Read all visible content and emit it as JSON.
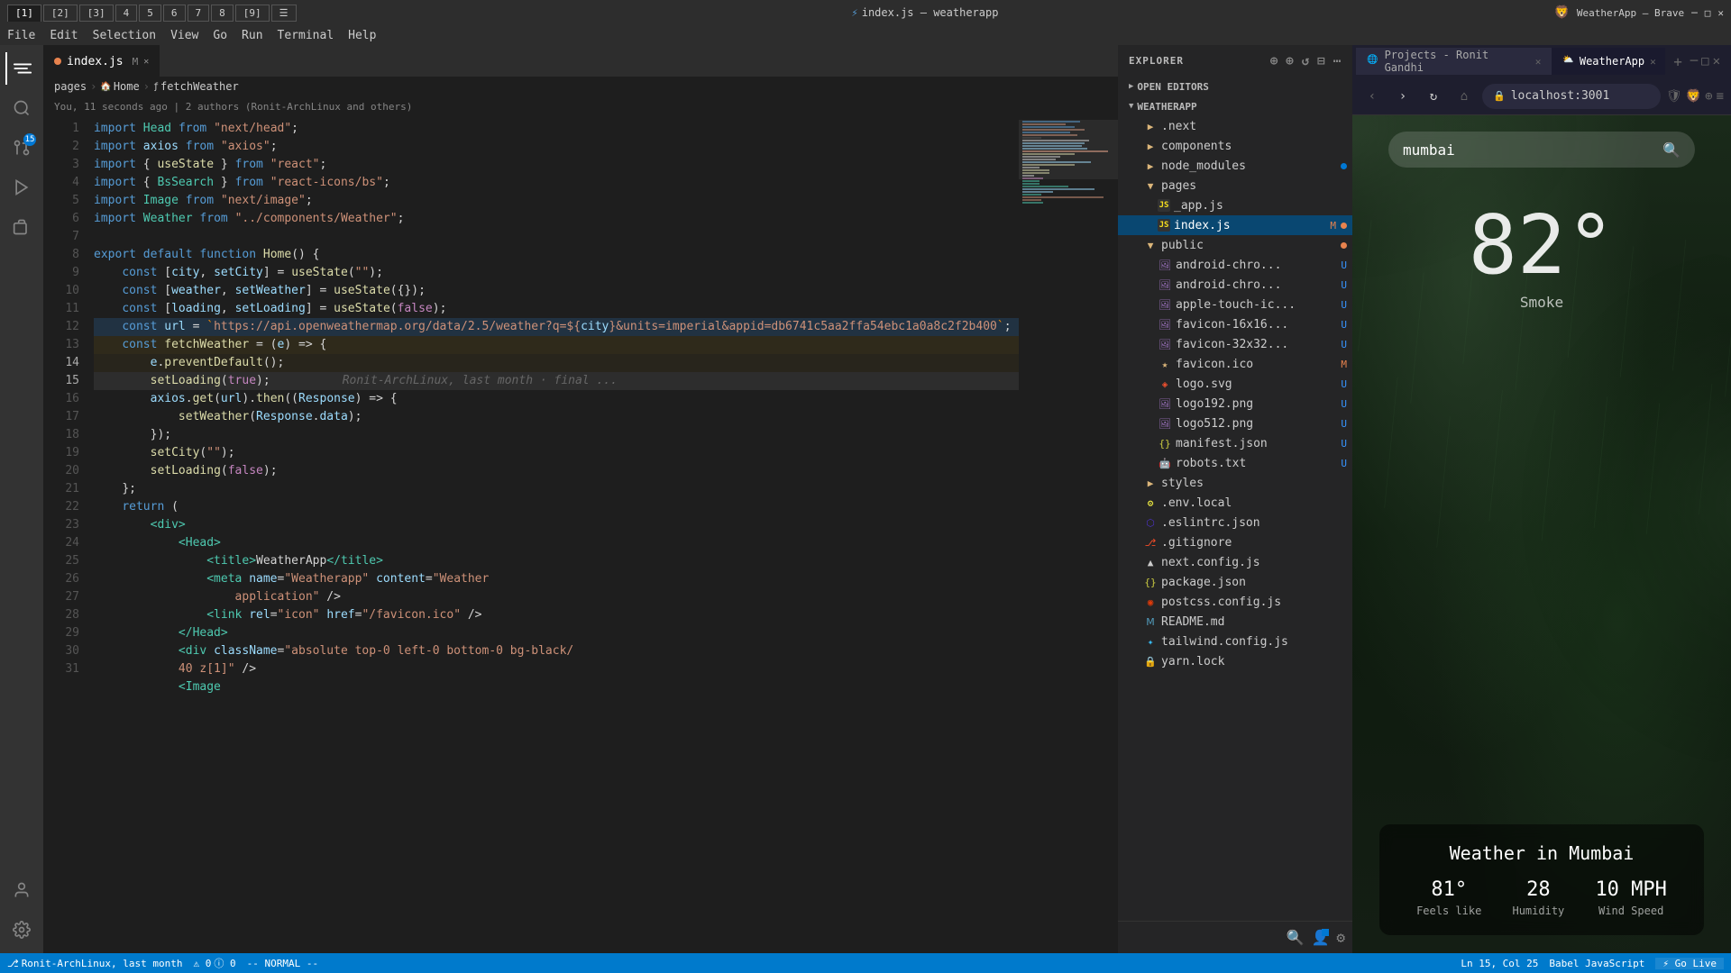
{
  "topbar": {
    "tabs": [
      {
        "label": "[1]",
        "active": true
      },
      {
        "label": "[2]",
        "active": false
      },
      {
        "label": "[3]",
        "active": false
      },
      {
        "label": "4",
        "active": false
      },
      {
        "label": "5",
        "active": false
      },
      {
        "label": "6",
        "active": false
      },
      {
        "label": "7",
        "active": false
      },
      {
        "label": "8",
        "active": false
      },
      {
        "label": "[9]",
        "active": false
      },
      {
        "label": "☰",
        "active": false
      }
    ],
    "title": "index.js — weatherapp"
  },
  "menu": {
    "items": [
      "File",
      "Edit",
      "Selection",
      "View",
      "Go",
      "Run",
      "Terminal",
      "Help"
    ]
  },
  "editor_tab": {
    "name": "index.js",
    "modified": true,
    "label": "M"
  },
  "breadcrumb": {
    "parts": [
      "pages",
      "›",
      "Home",
      "›",
      "fetchWeather"
    ]
  },
  "git_blame": "You, 11 seconds ago | 2 authors (Ronit-ArchLinux and others)",
  "code_lines": [
    {
      "num": 1,
      "content": "import Head from \"next/head\";"
    },
    {
      "num": 2,
      "content": "import axios from \"axios\";"
    },
    {
      "num": 3,
      "content": "import { useState } from \"react\";"
    },
    {
      "num": 4,
      "content": "import { BsSearch } from \"react-icons/bs\";"
    },
    {
      "num": 5,
      "content": "import Image from \"next/image\";"
    },
    {
      "num": 6,
      "content": "import Weather from \"../components/Weather\";"
    },
    {
      "num": 7,
      "content": ""
    },
    {
      "num": 8,
      "content": "export default function Home() {"
    },
    {
      "num": 9,
      "content": "  const [city, setCity] = useState(\"\");"
    },
    {
      "num": 10,
      "content": "  const [weather, setWeather] = useState({});"
    },
    {
      "num": 11,
      "content": "  const [loading, setLoading] = useState(false);"
    },
    {
      "num": 12,
      "content": "  const url = `https://api.openweathermap.org/data/2.5/weather?q=${city}&units=imperial&appid=db6741c5aa2ffa54ebc1a0a8c2f2b400`;"
    },
    {
      "num": 13,
      "content": "  const fetchWeather = (e) => {"
    },
    {
      "num": 14,
      "content": "    e.preventDefault();"
    },
    {
      "num": 15,
      "content": "    setLoading(true);"
    },
    {
      "num": 16,
      "content": "    axios.get(url).then((Response) => {"
    },
    {
      "num": 17,
      "content": "      setWeather(Response.data);"
    },
    {
      "num": 18,
      "content": "    });"
    },
    {
      "num": 19,
      "content": "    setCity(\"\");"
    },
    {
      "num": 20,
      "content": "    setLoading(false);"
    },
    {
      "num": 21,
      "content": "  };"
    },
    {
      "num": 22,
      "content": "  return ("
    },
    {
      "num": 23,
      "content": "    <div>"
    },
    {
      "num": 24,
      "content": "      <Head>"
    },
    {
      "num": 25,
      "content": "        <title>WeatherApp</title>"
    },
    {
      "num": 26,
      "content": "        <meta name=\"Weatherapp\" content=\"Weather application\" />"
    },
    {
      "num": 27,
      "content": "        <link rel=\"icon\" href=\"/favicon.ico\" />"
    },
    {
      "num": 28,
      "content": "      </Head>"
    },
    {
      "num": 29,
      "content": "      <div className=\"absolute top-0 left-0 bottom-0 bg-black/"
    },
    {
      "num": 30,
      "content": "      40 z[1]\" />"
    },
    {
      "num": 31,
      "content": "      <Image"
    }
  ],
  "ghost_text": {
    "line15": "Ronit-ArchLinux, last month · final ..."
  },
  "sidebar": {
    "header": "EXPLORER",
    "sections": {
      "open_editors": "OPEN EDITORS",
      "weatherapp": "WEATHERAPP"
    },
    "open_editors": [
      {
        "name": "index.js",
        "dot": "orange",
        "label": "M"
      }
    ],
    "tree": [
      {
        "name": ".next",
        "type": "folder",
        "indent": 1
      },
      {
        "name": "components",
        "type": "folder",
        "indent": 1
      },
      {
        "name": "node_modules",
        "type": "folder",
        "indent": 1,
        "dot": "blue"
      },
      {
        "name": "pages",
        "type": "folder",
        "indent": 1,
        "open": true
      },
      {
        "name": "_app.js",
        "type": "js",
        "indent": 2
      },
      {
        "name": "index.js",
        "type": "js",
        "indent": 2,
        "label": "M"
      },
      {
        "name": "public",
        "type": "folder",
        "indent": 1,
        "dot": "orange"
      },
      {
        "name": "android-chrome-...",
        "type": "png",
        "indent": 2,
        "label": "U"
      },
      {
        "name": "android-chrome-...",
        "type": "png",
        "indent": 2,
        "label": "U"
      },
      {
        "name": "apple-touch-ic...",
        "type": "png",
        "indent": 2,
        "label": "U"
      },
      {
        "name": "favicon-16x16...",
        "type": "png",
        "indent": 2,
        "label": "U"
      },
      {
        "name": "favicon-32x32...",
        "type": "png",
        "indent": 2,
        "label": "U"
      },
      {
        "name": "favicon.ico",
        "type": "ico",
        "indent": 2,
        "label": "M"
      },
      {
        "name": "logo.svg",
        "type": "svg",
        "indent": 2,
        "label": "U"
      },
      {
        "name": "logo192.png",
        "type": "png",
        "indent": 2,
        "label": "U"
      },
      {
        "name": "logo512.png",
        "type": "png",
        "indent": 2,
        "label": "U"
      },
      {
        "name": "manifest.json",
        "type": "json",
        "indent": 2,
        "label": "U"
      },
      {
        "name": "robots.txt",
        "type": "txt",
        "indent": 2,
        "label": "U"
      },
      {
        "name": "styles",
        "type": "folder",
        "indent": 1
      },
      {
        "name": ".env.local",
        "type": "env",
        "indent": 1
      },
      {
        "name": ".eslintrc.json",
        "type": "eslint",
        "indent": 1
      },
      {
        "name": ".gitignore",
        "type": "git",
        "indent": 1
      },
      {
        "name": "next.config.js",
        "type": "next",
        "indent": 1
      },
      {
        "name": "package.json",
        "type": "json",
        "indent": 1
      },
      {
        "name": "postcss.config.js",
        "type": "postcss",
        "indent": 1
      },
      {
        "name": "README.md",
        "type": "md",
        "indent": 1
      },
      {
        "name": "tailwind.config.js",
        "type": "tailwind",
        "indent": 1
      },
      {
        "name": "yarn.lock",
        "type": "lock",
        "indent": 1
      }
    ]
  },
  "browser": {
    "tabs": [
      {
        "label": "Projects - Ronit Gandhi",
        "active": false
      },
      {
        "label": "WeatherApp",
        "active": true
      }
    ],
    "url": "localhost:3001",
    "search_value": "mumbai",
    "temp": "82°",
    "weather_desc": "Smoke",
    "city_label": "Weather in Mumbai",
    "stats": [
      {
        "value": "81°",
        "label": "Feels like"
      },
      {
        "value": "28",
        "label": "Humidity"
      },
      {
        "value": "10 MPH",
        "label": "Wind Speed"
      }
    ]
  },
  "status_bar": {
    "left": [
      {
        "text": "⎇ Ronit-ArchLinux, last month"
      },
      {
        "text": "⚠ 0 ⓘ 0"
      },
      {
        "text": "-- NORMAL --"
      }
    ],
    "right": [
      {
        "text": "Ln 15, Col 25"
      },
      {
        "text": "Babel JavaScript"
      },
      {
        "text": "⚡ Go Live"
      }
    ]
  }
}
